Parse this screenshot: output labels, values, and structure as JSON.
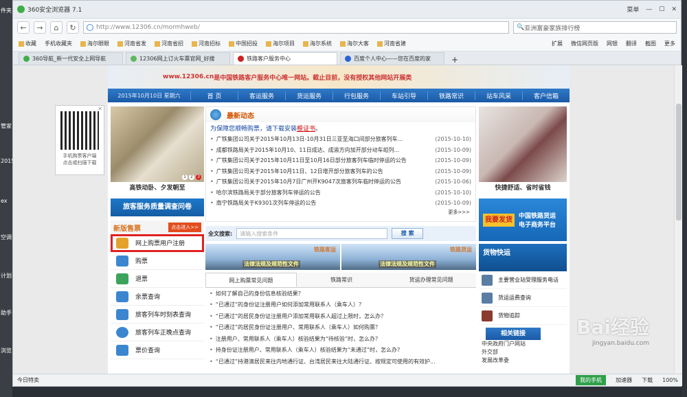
{
  "desktop": {
    "left_labels": [
      "件夹",
      "管家",
      "2015",
      "ex",
      "空调",
      "计划",
      "助手",
      "浏览"
    ]
  },
  "browser": {
    "title": "360安全浏览器 7.1",
    "window_controls": {
      "menu": "菜单"
    },
    "url": "http://www.12306.cn/mormhweb/",
    "search_placeholder": "亚洲富豪家族排行榜",
    "favorites": [
      "收藏",
      "手机收藏夹",
      "海尔眼眼",
      "河南省发",
      "河南省招",
      "河南招标",
      "中国招投",
      "海尔项目",
      "海尔系统",
      "海尔大客",
      "河南省建"
    ],
    "fav_right": [
      "扩展",
      "微信网页版",
      "网银",
      "翻译",
      "截图",
      "更多"
    ],
    "tabs": [
      {
        "label": "360导航_新一代安全上网导航",
        "active": false
      },
      {
        "label": "12306网上订火车票官网_好搜",
        "active": false
      },
      {
        "label": "铁路客户服务中心",
        "active": true
      },
      {
        "label": "百度个人中心——您在百度的家",
        "active": false
      }
    ],
    "status": {
      "left": "今日特卖",
      "phone": "我的手机",
      "accelerator": "加速器",
      "download": "下载",
      "zoom": "100%"
    }
  },
  "site": {
    "banner_url": "www.12306.cn",
    "banner_text": "是中国铁路客户服务中心唯一网站。截止目前，没有授权其他网站开展类",
    "date": "2015年10月10日 星期六",
    "menu": [
      "首 页",
      "客运服务",
      "货运服务",
      "行包服务",
      "车站引导",
      "铁路常识",
      "站车风采",
      "客户信箱"
    ],
    "qr": {
      "text1": "手机购票客户端",
      "text2": "点击或扫描下载"
    },
    "left_caption": "高铁动卧、夕发朝至",
    "survey_button": "旅客服务质量调查问卷",
    "new_sale": "新版售票",
    "enter": "点击进入>>",
    "left_menu": [
      "网上购票用户注册",
      "购票",
      "退票",
      "余票查询",
      "旅客列车时刻表查询",
      "旅客列车正晚点查询",
      "票价查询"
    ],
    "news": {
      "header": "最新动态",
      "warn_prefix": "为保障您顺畅购票，请下载安装",
      "warn_link": "根证书",
      "warn_suffix": "。",
      "items": [
        {
          "title": "广铁集团公司关于2015年10月13日-10月31日三亚至海口间部分旅客列车...",
          "date": "(2015-10-10)"
        },
        {
          "title": "成都铁路局关于2015年10月10、11日成达、成渝方向加开部分动车组列...",
          "date": "(2015-10-09)"
        },
        {
          "title": "广铁集团公司关于2015年10月11日至10月16日部分旅客列车临时停运的公告",
          "date": "(2015-10-09)"
        },
        {
          "title": "广铁集团公司关于2015年10月11日、12日增开部分旅客列车的公告",
          "date": "(2015-10-09)"
        },
        {
          "title": "广铁集团公司关于2015年10月7日广州开K9047次旅客列车临时停运的公告",
          "date": "(2015-10-06)"
        },
        {
          "title": "哈尔滨铁路局关于部分旅客列车停运的公告",
          "date": "(2015-10-10)"
        },
        {
          "title": "南宁铁路局关于K9301次列车停运的公告",
          "date": "(2015-10-09)"
        }
      ],
      "more": "更多>>>"
    },
    "search": {
      "label": "全文搜索:",
      "placeholder": "请输入搜索条件",
      "button": "搜 索"
    },
    "rails": [
      {
        "label": "铁路客运",
        "law": "法律法规及规范性文件"
      },
      {
        "label": "铁路货运",
        "law": "法律法规及规范性文件"
      }
    ],
    "faq_tabs": [
      "网上购票常见问题",
      "铁路常识",
      "货运办理常见问题"
    ],
    "faq": [
      "如何了解自己的身份信息核验结果？",
      "“已通过”的身份证注册用户如何添加常用联系人（乘车人）？",
      "“已通过”的居民身份证注册用户添加常用联系人超过上限时，怎么办？",
      "“已通过”的居民身份证注册用户、常用联系人（乘车人）如何购票？",
      "注册用户、常用联系人（乘车人）核验结果为“待核验”时，怎么办？",
      "持身份证注册用户、常用联系人（乘车人）核验结果为“未通过”时，怎么办？",
      "“已通过”持港澳居民来往内地通行证、台湾居民来往大陆通行证、按规定可使用的有效护..."
    ],
    "right_caption": "快捷舒适、省时省钱",
    "ad1": {
      "tag": "我要发货",
      "text1": "中国铁路货运",
      "text2": "电子商务平台"
    },
    "ad2": "货物快运",
    "right_list": [
      "主要营业站受理服务电话",
      "货运运费查询",
      "货物追踪"
    ],
    "links": {
      "header": "相关链接",
      "items": [
        "中央政府门户网站",
        "外交部",
        "发展改革委"
      ]
    },
    "watermark": "Bai经验",
    "watermark_url": "jingyan.baidu.com"
  }
}
